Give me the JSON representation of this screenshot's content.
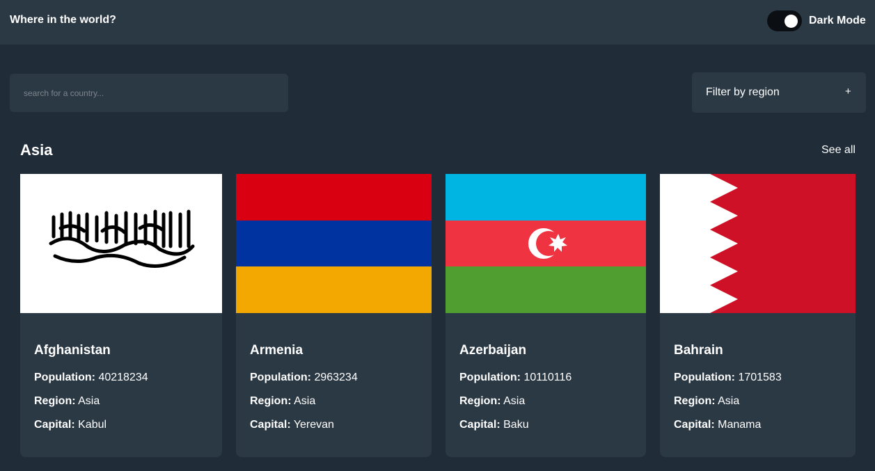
{
  "header": {
    "title": "Where in the world?",
    "mode_label": "Dark Mode"
  },
  "search": {
    "placeholder": "search for a country..."
  },
  "filter": {
    "label": "Filter by region",
    "icon": "plus-icon",
    "icon_glyph": "+"
  },
  "section": {
    "title": "Asia",
    "see_all": "See all"
  },
  "labels": {
    "population": "Population:",
    "region": "Region:",
    "capital": "Capital:"
  },
  "countries": [
    {
      "name": "Afghanistan",
      "population": "40218234",
      "region": "Asia",
      "capital": "Kabul"
    },
    {
      "name": "Armenia",
      "population": "2963234",
      "region": "Asia",
      "capital": "Yerevan"
    },
    {
      "name": "Azerbaijan",
      "population": "10110116",
      "region": "Asia",
      "capital": "Baku"
    },
    {
      "name": "Bahrain",
      "population": "1701583",
      "region": "Asia",
      "capital": "Manama"
    }
  ],
  "colors": {
    "background": "#202c37",
    "element": "#2b3945",
    "text": "#ffffff"
  }
}
